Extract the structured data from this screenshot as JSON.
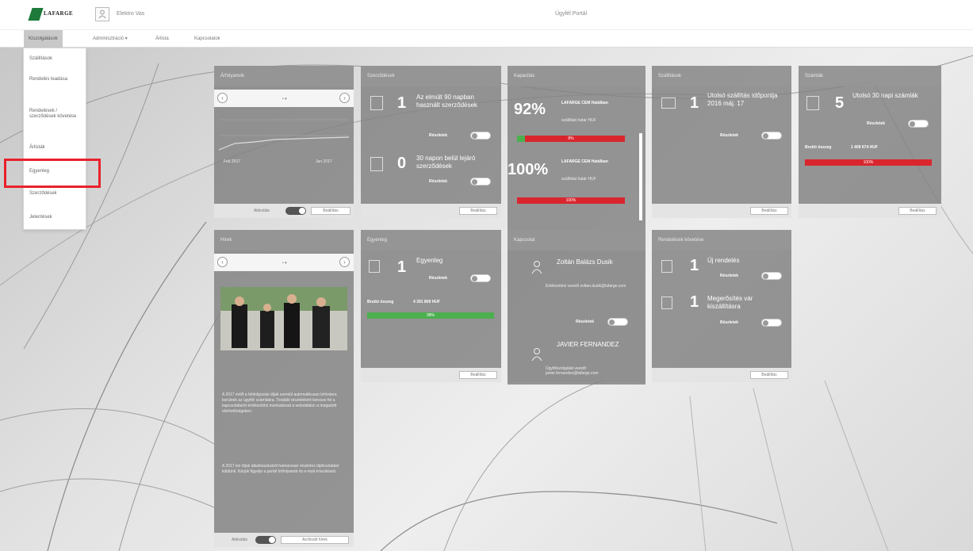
{
  "header": {
    "logo_text": "LAFARGE",
    "user_name": "Elektro Vas",
    "portal_title": "Ügyfél Portál"
  },
  "nav": {
    "items": [
      {
        "label": "Kiszolgálások"
      },
      {
        "label": "Adminisztráció ▾"
      },
      {
        "label": "Árlista"
      },
      {
        "label": "Kapcsolatok"
      }
    ]
  },
  "dropdown": {
    "items": [
      {
        "label": "Szállítások"
      },
      {
        "label": "Rendelés leadása"
      },
      {
        "label": "Rendelések / szerződések követése"
      },
      {
        "label": "Árlisták"
      },
      {
        "label": "Egyenleg"
      },
      {
        "label": "Szerződések"
      },
      {
        "label": "Jelentések"
      }
    ],
    "highlighted": "Egyenleg"
  },
  "cards": {
    "arfolyam": {
      "title": "Árfolyamok",
      "chart_label_left": "Feb 2017",
      "chart_label_right": "Jun 2017",
      "footer_toggle_label": "Aktiválás",
      "footer_button": "Beállítás"
    },
    "szerzodesek": {
      "title": "Szerződések",
      "count1": "1",
      "text1": "Az elmúlt 90 napban használt szerződések",
      "link1": "Részletek",
      "count2": "0",
      "text2": "30 napon belül lejáró szerződések",
      "link2": "Részletek",
      "footer_button": "Beállítás"
    },
    "kapacitas": {
      "title": "Kapacitás",
      "pct1": "92%",
      "label1": "LAFARGE CEM Hatálban",
      "sub1": "szállítási határ HUF",
      "bar1_label": "8%",
      "pct2": "100%",
      "label2": "LAFARGE CEM Hatálban",
      "sub2": "szállítási határ HUF",
      "bar2_label": "100%"
    },
    "szallitas": {
      "title": "Szállítások",
      "count": "1",
      "text": "Utolsó szállítás időpontja 2016 máj. 17",
      "link": "Részletek",
      "footer_button": "Beállítás"
    },
    "szamlak": {
      "title": "Számlák",
      "count": "5",
      "text": "Utolsó 30 napi számlák",
      "link": "Részletek",
      "total_label": "Bruttó összeg",
      "total_value": "1 409 674 HUF",
      "bar_label": "100%",
      "footer_button": "Beállítás"
    },
    "hirek": {
      "title": "Hírek",
      "paragraph1": "A 2017 évtől a feldolgozási díjak ezentúl automatikusan lehívásra kerülnek az ügyféli számlákra. További részletekért keresse fel a kapcsolattartó értékesítési munkatársat a weboldalon a megadott elérhetőségeken.",
      "paragraph2": "A 2017 évi díjak alkalmazásáról hamarosan részletes tájékoztatást küldünk. Kérjük figyelje a portál hírfolyamát és e-mail értesítéseit.",
      "footer_toggle_label": "Aktiválás",
      "footer_button": "Archivált hírek"
    },
    "egyenleg": {
      "title": "Egyenleg",
      "count": "1",
      "text": "Egyenleg",
      "link": "Részletek",
      "total_label": "Bruttó összeg",
      "total_value": "4 391 809 HUF",
      "bar_label": "98%",
      "footer_button": "Beállítás"
    },
    "kapcsolat": {
      "title": "Kapcsolat",
      "name1": "Zoltán Balázs Dusik",
      "role1": "Értékesítési vezető zoltan.dusik@lafarge.com",
      "link": "Részletek",
      "name2": "JAVIER FERNANDEZ",
      "role2": "Ügyfélszolgálati vezető javier.fernandez@lafarge.com"
    },
    "rendelesek": {
      "title": "Rendelések követése",
      "count1": "1",
      "text1": "Új rendelés",
      "link1": "Részletek",
      "count2": "1",
      "text2": "Megerősítés vár kiszállításra",
      "link2": "Részletek",
      "footer_button": "Beállítás"
    }
  },
  "colors": {
    "accent_red": "#d9262e",
    "accent_green": "#4caf50",
    "brand_green": "#1e7a3a",
    "highlight_box": "#e8212b"
  }
}
